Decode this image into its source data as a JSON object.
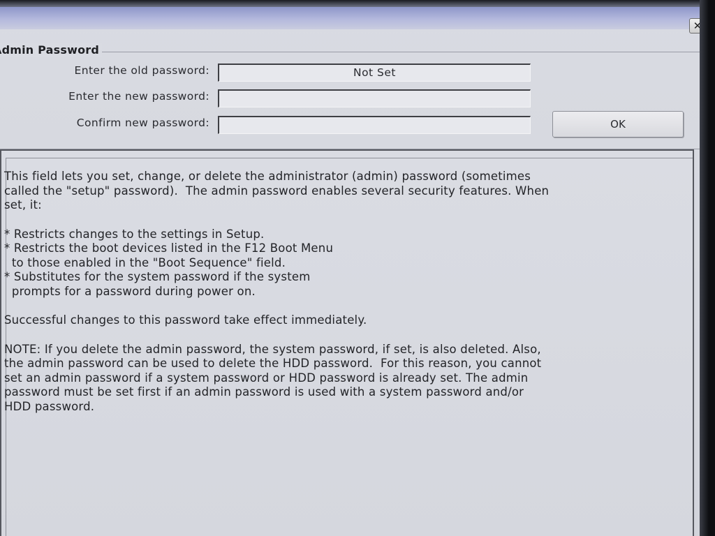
{
  "window": {
    "close_glyph": "✕"
  },
  "admin_password": {
    "group_title": "Admin Password",
    "old_label": "Enter the old password:",
    "old_value": "Not Set",
    "new_label": "Enter the new password:",
    "new_value": "",
    "confirm_label": "Confirm new password:",
    "confirm_value": "",
    "ok_label": "OK"
  },
  "help": {
    "intro": "This field lets you set, change, or delete the administrator (admin) password (sometimes\ncalled the \"setup\" password).  The admin password enables several security features. When\nset, it:",
    "bullets": "* Restricts changes to the settings in Setup.\n* Restricts the boot devices listed in the F12 Boot Menu\n  to those enabled in the \"Boot Sequence\" field.\n* Substitutes for the system password if the system\n  prompts for a password during power on.",
    "success": "Successful changes to this password take effect immediately.",
    "note": "NOTE: If you delete the admin password, the system password, if set, is also deleted. Also,\nthe admin password can be used to delete the HDD password.  For this reason, you cannot\nset an admin password if a system password or HDD password is already set. The admin\npassword must be set first if an admin password is used with a system password and/or\nHDD password."
  }
}
